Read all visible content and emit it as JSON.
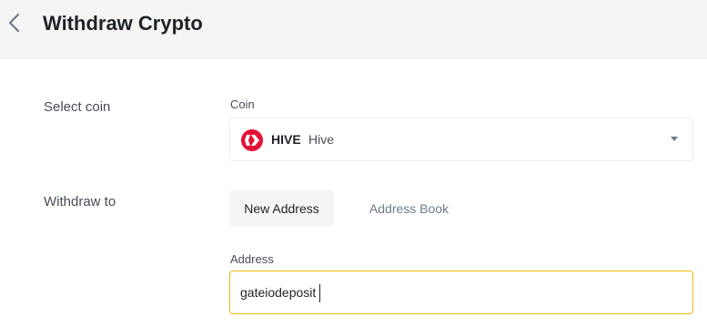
{
  "header": {
    "title": "Withdraw Crypto",
    "back_icon": "chevron-left-icon"
  },
  "select_coin": {
    "row_label": "Select coin",
    "field_label": "Coin",
    "selected": {
      "symbol": "HIVE",
      "name": "Hive",
      "logo_icon": "hive-logo-icon",
      "logo_color": "#e31337"
    },
    "arrow_icon": "caret-down-icon"
  },
  "withdraw_to": {
    "row_label": "Withdraw to",
    "tabs": [
      {
        "label": "New Address",
        "active": true
      },
      {
        "label": "Address Book",
        "active": false
      }
    ],
    "address_label": "Address",
    "address_value": "gateiodeposit",
    "focus_color": "#f0b90b"
  }
}
